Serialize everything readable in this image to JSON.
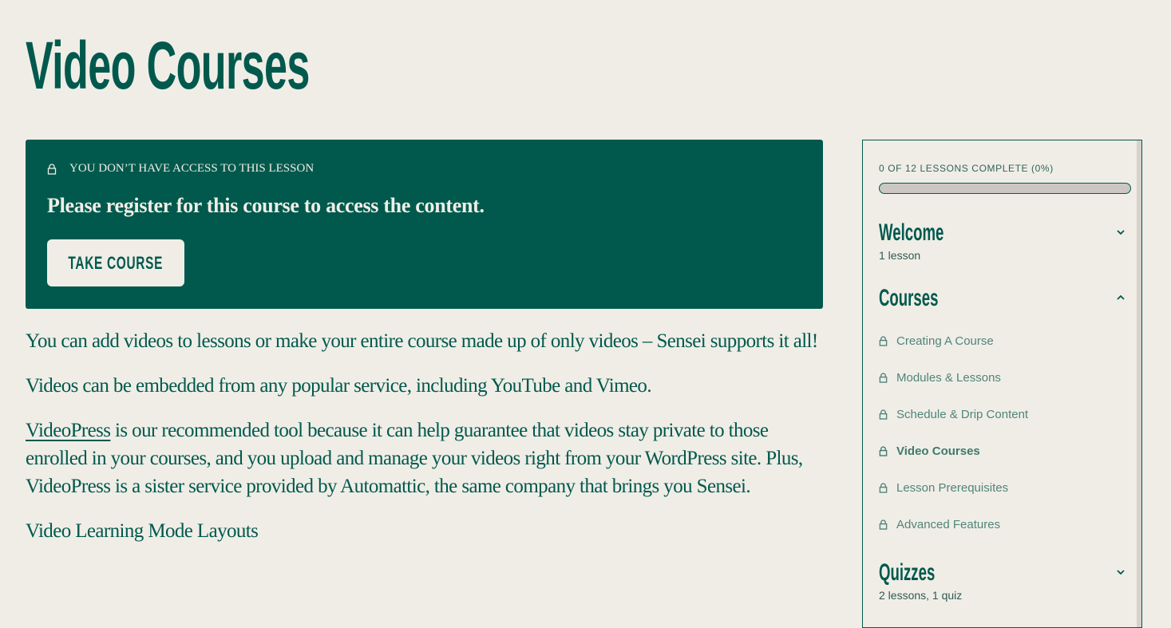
{
  "page": {
    "title": "Video Courses"
  },
  "notice": {
    "icon": "lock-icon",
    "heading": "YOU DON’T HAVE ACCESS TO THIS LESSON",
    "message": "Please register for this course to access the content.",
    "button_label": "TAKE COURSE"
  },
  "content": {
    "paragraphs": [
      "You can add videos to lessons or make your entire course made up of only videos – Sensei supports it all!",
      "Videos can be embedded from any popular service, including YouTube and Vimeo."
    ],
    "videopress_link": "VideoPress",
    "videopress_rest": " is our recommended tool because it can help guarantee that videos stay private to those enrolled in your courses, and you upload and manage your videos right from your WordPress site. Plus, VideoPress is a sister service provided by Automattic, the same company that brings you Sensei.",
    "last_paragraph": "Video Learning Mode Layouts"
  },
  "sidebar": {
    "progress_label": "0 OF 12 LESSONS COMPLETE (0%)",
    "progress_percent": 0,
    "modules": [
      {
        "title": "Welcome",
        "subtitle": "1 lesson",
        "expanded": false
      },
      {
        "title": "Courses",
        "expanded": true,
        "lessons": [
          {
            "label": "Creating A Course",
            "locked": true,
            "current": false
          },
          {
            "label": "Modules & Lessons",
            "locked": true,
            "current": false
          },
          {
            "label": "Schedule & Drip Content",
            "locked": true,
            "current": false
          },
          {
            "label": "Video Courses",
            "locked": true,
            "current": true
          },
          {
            "label": "Lesson Prerequisites",
            "locked": true,
            "current": false
          },
          {
            "label": "Advanced Features",
            "locked": true,
            "current": false
          }
        ]
      },
      {
        "title": "Quizzes",
        "subtitle": "2 lessons, 1 quiz",
        "expanded": false
      }
    ]
  },
  "colors": {
    "brand": "#00594c",
    "background": "#f0ede7",
    "progress_track": "#cbc7c2"
  }
}
